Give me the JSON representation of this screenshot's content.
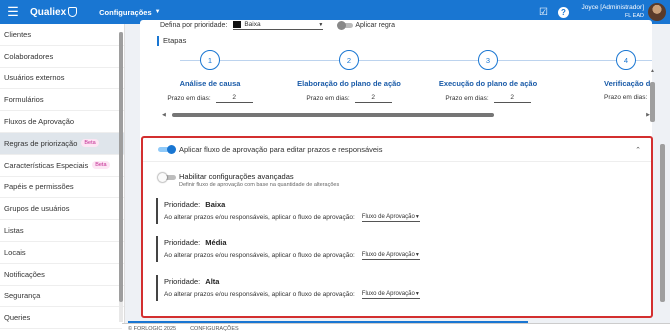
{
  "header": {
    "app_name": "Qualiex",
    "module": "Configurações",
    "user_name": "Joyce [Administrador]",
    "user_company": "FL EAD"
  },
  "sidebar": {
    "items": [
      {
        "label": "Clientes"
      },
      {
        "label": "Colaboradores"
      },
      {
        "label": "Usuários externos"
      },
      {
        "label": "Formulários"
      },
      {
        "label": "Fluxos de Aprovação"
      },
      {
        "label": "Regras de priorização",
        "badge": "Beta",
        "active": true
      },
      {
        "label": "Características Especiais",
        "badge": "Beta"
      },
      {
        "label": "Papéis e permissões"
      },
      {
        "label": "Grupos de usuários"
      },
      {
        "label": "Listas"
      },
      {
        "label": "Locais"
      },
      {
        "label": "Notificações"
      },
      {
        "label": "Segurança"
      },
      {
        "label": "Queries"
      }
    ]
  },
  "priority_rule": {
    "label": "Defina por prioridade:",
    "selected": "Baixa",
    "apply_label": "Aplicar regra"
  },
  "etapas": {
    "title": "Etapas",
    "prazo_label": "Prazo em dias:",
    "steps": [
      {
        "number": "1",
        "title": "Análise de causa",
        "days": "2"
      },
      {
        "number": "2",
        "title": "Elaboração do plano de ação",
        "days": "2"
      },
      {
        "number": "3",
        "title": "Execução do plano de ação",
        "days": "2"
      },
      {
        "number": "4",
        "title": "Verificação d",
        "days": ""
      }
    ]
  },
  "approval": {
    "toggle_label": "Aplicar fluxo de aprovação para editar prazos e responsáveis",
    "advanced_title": "Habilitar configurações avançadas",
    "advanced_desc": "Definir fluxo de aprovação com base na quantidade de alterações",
    "priority_prefix": "Prioridade:",
    "rule_text": "Ao alterar prazos e/ou responsáveis, aplicar o fluxo de aprovação:",
    "priorities": [
      {
        "name": "Baixa",
        "flow": "Fluxo de Aprovação"
      },
      {
        "name": "Média",
        "flow": "Fluxo de Aprovação"
      },
      {
        "name": "Alta",
        "flow": "Fluxo de Aprovação"
      }
    ]
  },
  "footer": {
    "copyright": "© FORLOGIC 2025",
    "section": "CONFIGURAÇÕES"
  },
  "colors": {
    "primary": "#1976d2",
    "highlight_border": "#d32f2f",
    "beta_bg": "#fde5f4",
    "beta_text": "#c0268f"
  }
}
